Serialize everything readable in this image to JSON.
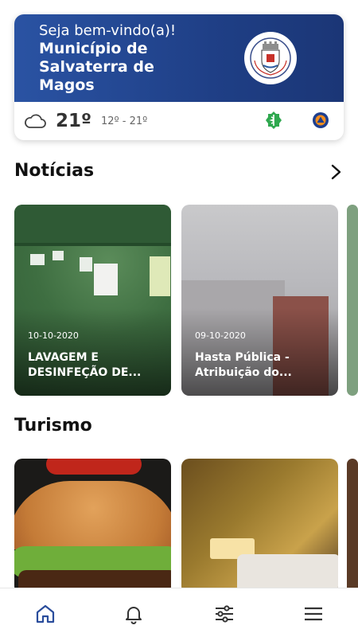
{
  "header": {
    "greeting": "Seja bem-vindo(a)!",
    "municipality": "Município de Salvaterra de Magos",
    "brand_color": "#1f3f86"
  },
  "weather": {
    "icon": "cloud-icon",
    "temperature": "21º",
    "range": "12º - 21º"
  },
  "sections": {
    "news_title": "Notícias",
    "tourism_title": "Turismo"
  },
  "news": [
    {
      "date": "10-10-2020",
      "title": "LAVAGEM E DESINFEÇÃO DE..."
    },
    {
      "date": "09-10-2020",
      "title": "Hasta Pública - Atribuição do..."
    }
  ],
  "nav": [
    {
      "icon": "home-icon",
      "active": true
    },
    {
      "icon": "bell-icon"
    },
    {
      "icon": "sliders-icon"
    },
    {
      "icon": "menu-icon"
    }
  ]
}
